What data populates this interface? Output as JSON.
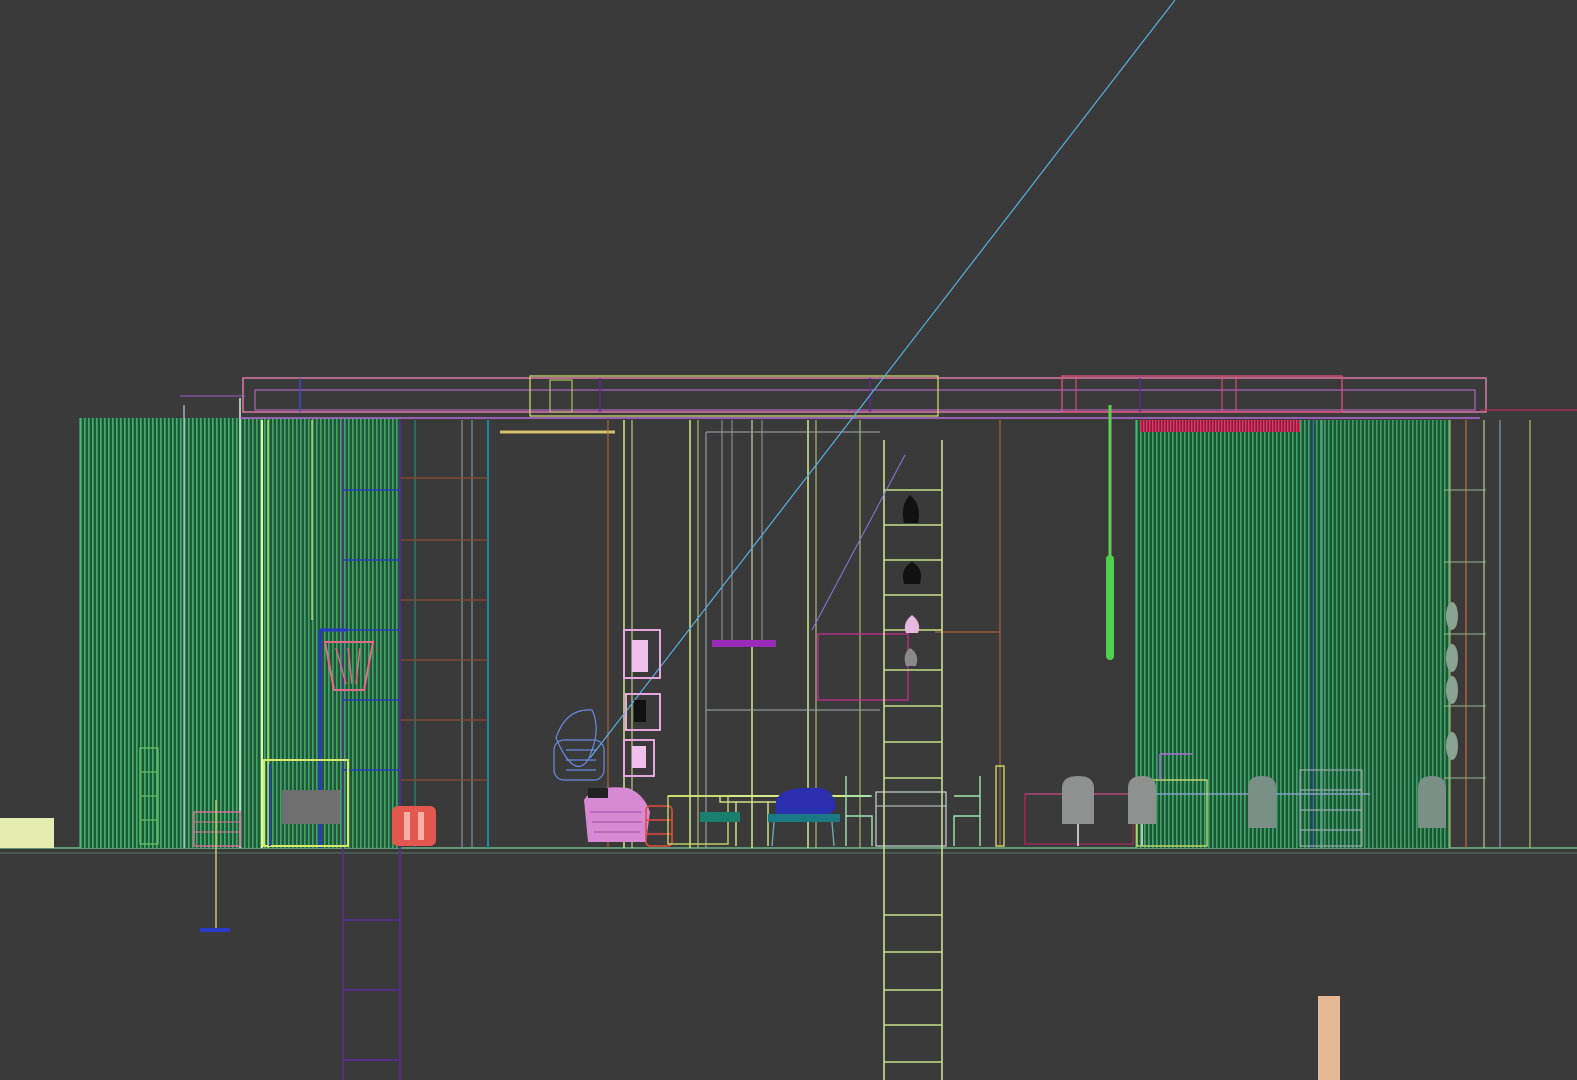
{
  "viewport": {
    "background": "#3a3a3a",
    "mode": "wireframe",
    "view": "front elevation",
    "interactive": true
  },
  "palette": {
    "curtain": "#3aa864",
    "curtain_fill": "#1f6e43",
    "ceiling_pink": "#e77fb0",
    "ceiling_yellow": "#c9d86b",
    "ladder_purple": "#5b2a9c",
    "ladder_yellow": "#c8e08a",
    "sightline": "#5aaee0",
    "ground": "#6fb486",
    "lamp_red": "#e2584f",
    "chair_grey": "#7f8a84",
    "chair_pink": "#d889d4",
    "chair_blue": "#2a2fb0",
    "accent_red": "#d6305f",
    "slab_cream": "#e4ecb0",
    "tan_post": "#e6b896"
  },
  "objects": [
    {
      "name": "left-curtain-panel",
      "kind": "curtain",
      "interactable": true
    },
    {
      "name": "right-curtain-panel",
      "kind": "curtain",
      "interactable": true
    },
    {
      "name": "ceiling-beam",
      "kind": "beam",
      "interactable": true
    },
    {
      "name": "left-ladder",
      "kind": "ladder",
      "interactable": true
    },
    {
      "name": "center-ladder",
      "kind": "ladder",
      "interactable": true
    },
    {
      "name": "sightline",
      "kind": "camera target line",
      "interactable": true
    },
    {
      "name": "ground-line",
      "kind": "floor",
      "interactable": false
    },
    {
      "name": "floor-lamp",
      "kind": "lamp",
      "interactable": true
    },
    {
      "name": "red-side-table",
      "kind": "table",
      "interactable": true
    },
    {
      "name": "pink-lounge-chair",
      "kind": "chair",
      "interactable": true
    },
    {
      "name": "blue-armchair",
      "kind": "chair",
      "interactable": true
    },
    {
      "name": "right-dining-chairs",
      "kind": "chair",
      "interactable": true
    },
    {
      "name": "cream-slab",
      "kind": "box",
      "interactable": true
    },
    {
      "name": "tan-post",
      "kind": "box",
      "interactable": true
    }
  ]
}
